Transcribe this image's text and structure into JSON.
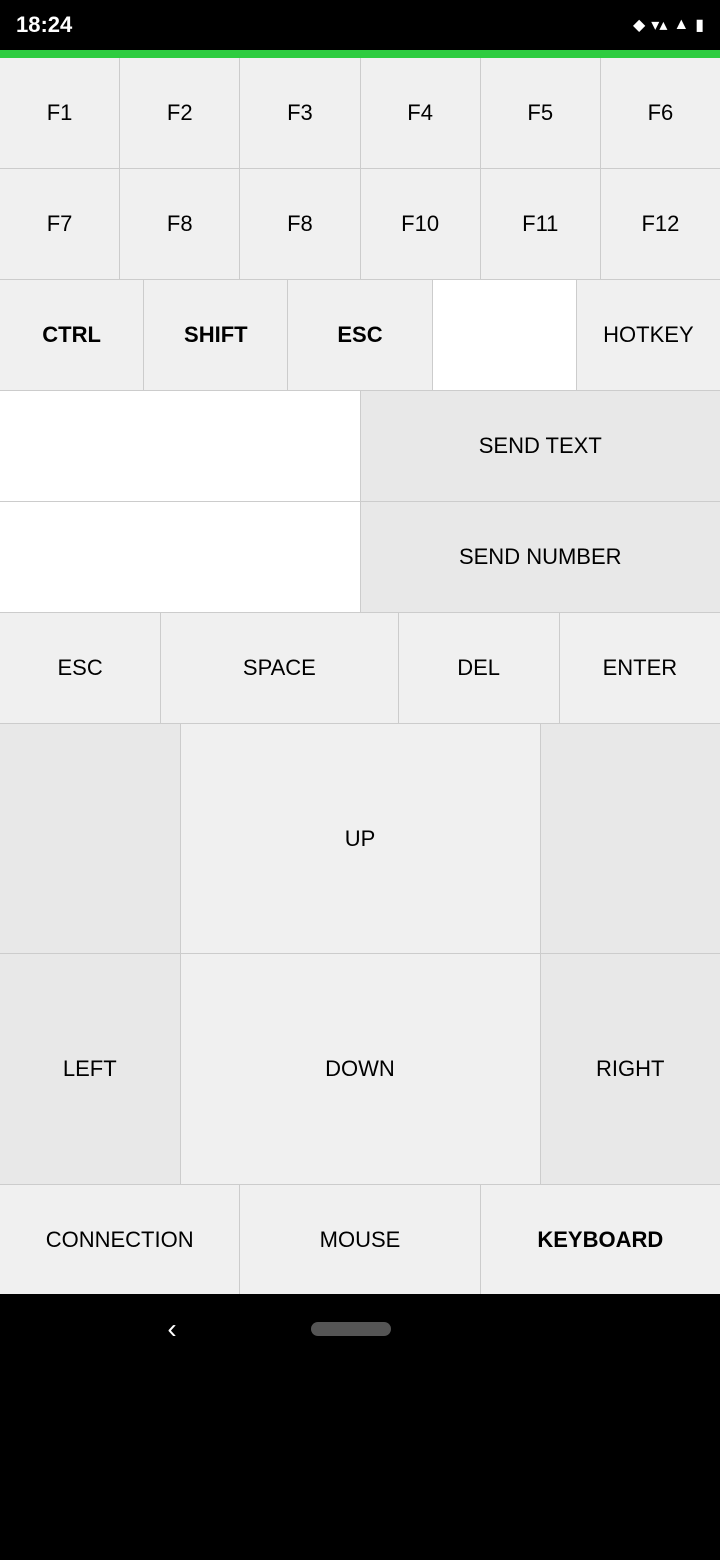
{
  "statusBar": {
    "time": "18:24",
    "icons": [
      "◆",
      "▼",
      "▲",
      "▲",
      "🔋"
    ]
  },
  "frow1": {
    "keys": [
      "F1",
      "F2",
      "F3",
      "F4",
      "F5",
      "F6"
    ]
  },
  "frow2": {
    "keys": [
      "F7",
      "F8",
      "F8",
      "F10",
      "F11",
      "F12"
    ]
  },
  "modRow": {
    "ctrl": "CTRL",
    "shift": "SHIFT",
    "esc": "ESC",
    "hotkey": "HOTKEY"
  },
  "sendRow": {
    "sendText": "SEND TEXT",
    "sendNumber": "SEND NUMBER"
  },
  "editRow": {
    "esc": "ESC",
    "space": "SPACE",
    "del": "DEL",
    "enter": "ENTER"
  },
  "dpad": {
    "up": "UP",
    "down": "DOWN",
    "left": "LEFT",
    "right": "RIGHT"
  },
  "bottomTabs": {
    "connection": "CONNECTION",
    "mouse": "MOUSE",
    "keyboard": "KEYBOARD"
  }
}
